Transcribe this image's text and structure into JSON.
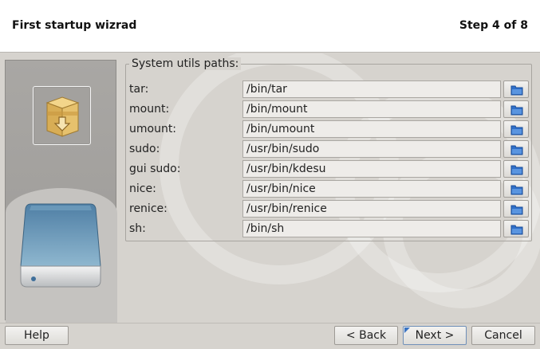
{
  "header": {
    "title": "First startup wizrad",
    "step": "Step 4 of 8"
  },
  "sidebar": {
    "package_icon": "package-install-icon",
    "drive_icon": "removable-drive-icon"
  },
  "group": {
    "legend": "System utils paths:",
    "rows": [
      {
        "label": "tar:",
        "value": "/bin/tar"
      },
      {
        "label": "mount:",
        "value": "/bin/mount"
      },
      {
        "label": "umount:",
        "value": "/bin/umount"
      },
      {
        "label": "sudo:",
        "value": "/usr/bin/sudo"
      },
      {
        "label": "gui sudo:",
        "value": "/usr/bin/kdesu"
      },
      {
        "label": "nice:",
        "value": "/usr/bin/nice"
      },
      {
        "label": "renice:",
        "value": "/usr/bin/renice"
      },
      {
        "label": "sh:",
        "value": "/bin/sh"
      }
    ],
    "browse_icon": "folder-icon"
  },
  "footer": {
    "help": "Help",
    "back": "< Back",
    "next": "Next >",
    "cancel": "Cancel"
  },
  "colors": {
    "folder_blue": "#2f6fc9",
    "accent": "#3a74c4"
  }
}
